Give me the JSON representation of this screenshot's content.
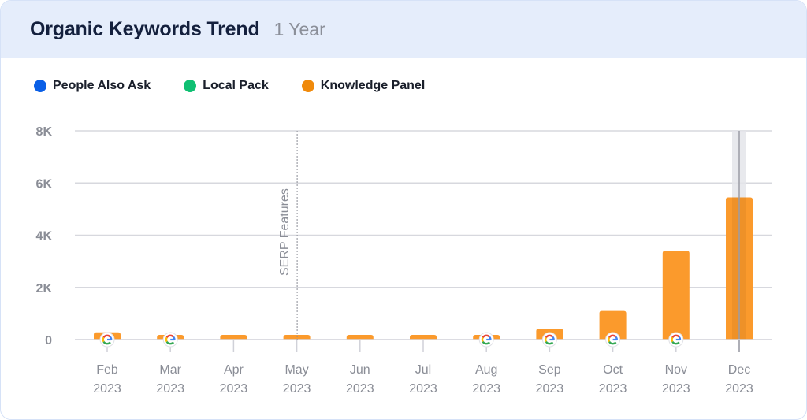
{
  "header": {
    "title": "Organic Keywords Trend",
    "period": "1 Year"
  },
  "legend": [
    {
      "label": "People Also Ask",
      "color": "#0a5fe6"
    },
    {
      "label": "Local Pack",
      "color": "#0fbf72"
    },
    {
      "label": "Knowledge Panel",
      "color": "#f08a0c"
    }
  ],
  "chart_data": {
    "type": "bar",
    "title": "Organic Keywords Trend",
    "xlabel": "",
    "ylabel": "",
    "categories": [
      "Feb 2023",
      "Mar 2023",
      "Apr 2023",
      "May 2023",
      "Jun 2023",
      "Jul 2023",
      "Aug 2023",
      "Sep 2023",
      "Oct 2023",
      "Nov 2023",
      "Dec 2023"
    ],
    "x_tick_months": [
      "Feb",
      "Mar",
      "Apr",
      "May",
      "Jun",
      "Jul",
      "Aug",
      "Sep",
      "Oct",
      "Nov",
      "Dec"
    ],
    "x_tick_years": [
      "2023",
      "2023",
      "2023",
      "2023",
      "2023",
      "2023",
      "2023",
      "2023",
      "2023",
      "2023",
      "2023"
    ],
    "series": [
      {
        "name": "People Also Ask",
        "color": "#0a5fe6",
        "values": [
          0,
          0,
          0,
          0,
          0,
          0,
          0,
          0,
          0,
          0,
          0
        ]
      },
      {
        "name": "Local Pack",
        "color": "#0fbf72",
        "values": [
          0,
          0,
          0,
          0,
          0,
          0,
          0,
          0,
          0,
          0,
          0
        ]
      },
      {
        "name": "Knowledge Panel",
        "color": "#fb9a2c",
        "values": [
          280,
          180,
          180,
          180,
          180,
          180,
          180,
          420,
          1100,
          3400,
          5450
        ]
      }
    ],
    "ylim": [
      0,
      8000
    ],
    "y_ticks": [
      0,
      2000,
      4000,
      6000,
      8000
    ],
    "y_tick_labels": [
      "0",
      "2K",
      "4K",
      "6K",
      "8K"
    ],
    "grid": true,
    "legend_position": "top-left",
    "google_update_markers": [
      "Feb 2023",
      "Mar 2023",
      "Aug 2023",
      "Sep 2023",
      "Oct 2023",
      "Nov 2023"
    ],
    "annotations": [
      {
        "x": "May 2023",
        "label": "SERP Features",
        "style": "dotted-vertical-line"
      }
    ],
    "highlighted_category": "Dec 2023"
  }
}
